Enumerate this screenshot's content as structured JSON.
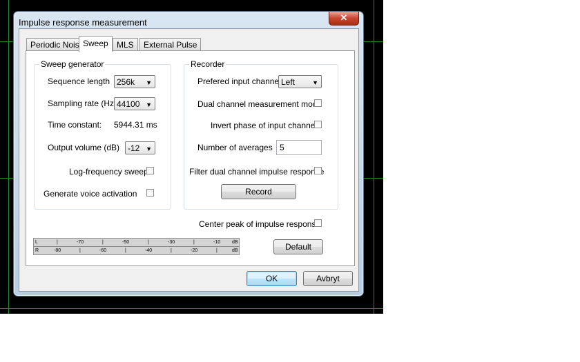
{
  "window": {
    "title": "Impulse response measurement",
    "close_label": "✕"
  },
  "tabs": [
    {
      "label": "Periodic Noise",
      "active": false
    },
    {
      "label": "Sweep",
      "active": true
    },
    {
      "label": "MLS",
      "active": false
    },
    {
      "label": "External Pulse",
      "active": false
    }
  ],
  "sweep_generator": {
    "title": "Sweep generator",
    "sequence_length_label": "Sequence length",
    "sequence_length_value": "256k",
    "sampling_rate_label": "Sampling rate (Hz)",
    "sampling_rate_value": "44100",
    "time_constant_label": "Time constant:",
    "time_constant_value": "5944.31 ms",
    "output_volume_label": "Output volume (dB)",
    "output_volume_value": "-12",
    "log_frequency_label": "Log-frequency sweep",
    "log_frequency_checked": false,
    "voice_activation_label": "Generate voice activation",
    "voice_activation_checked": false
  },
  "recorder": {
    "title": "Recorder",
    "input_channel_label": "Prefered input channel",
    "input_channel_value": "Left",
    "dual_channel_label": "Dual channel measurement mode",
    "dual_channel_checked": false,
    "invert_phase_label": "Invert phase of input channel",
    "invert_phase_checked": false,
    "averages_label": "Number of averages",
    "averages_value": "5",
    "filter_dual_label": "Filter dual channel impulse response",
    "filter_dual_checked": false,
    "record_label": "Record"
  },
  "center_peak": {
    "label": "Center peak of impulse response",
    "checked": false
  },
  "meter": {
    "left_channel": "L",
    "right_channel": "R",
    "left_ticks": [
      "-70",
      "-50",
      "-30",
      "-10",
      "dB"
    ],
    "right_ticks": [
      "-80",
      "-60",
      "-40",
      "-20",
      "dB"
    ]
  },
  "buttons": {
    "default_label": "Default",
    "ok_label": "OK",
    "cancel_label": "Avbryt"
  },
  "colors": {
    "background": "#000000",
    "grid": "#1f8a2a",
    "dialog_frame": "#c8d8e8",
    "close_button": "#c7452e"
  }
}
